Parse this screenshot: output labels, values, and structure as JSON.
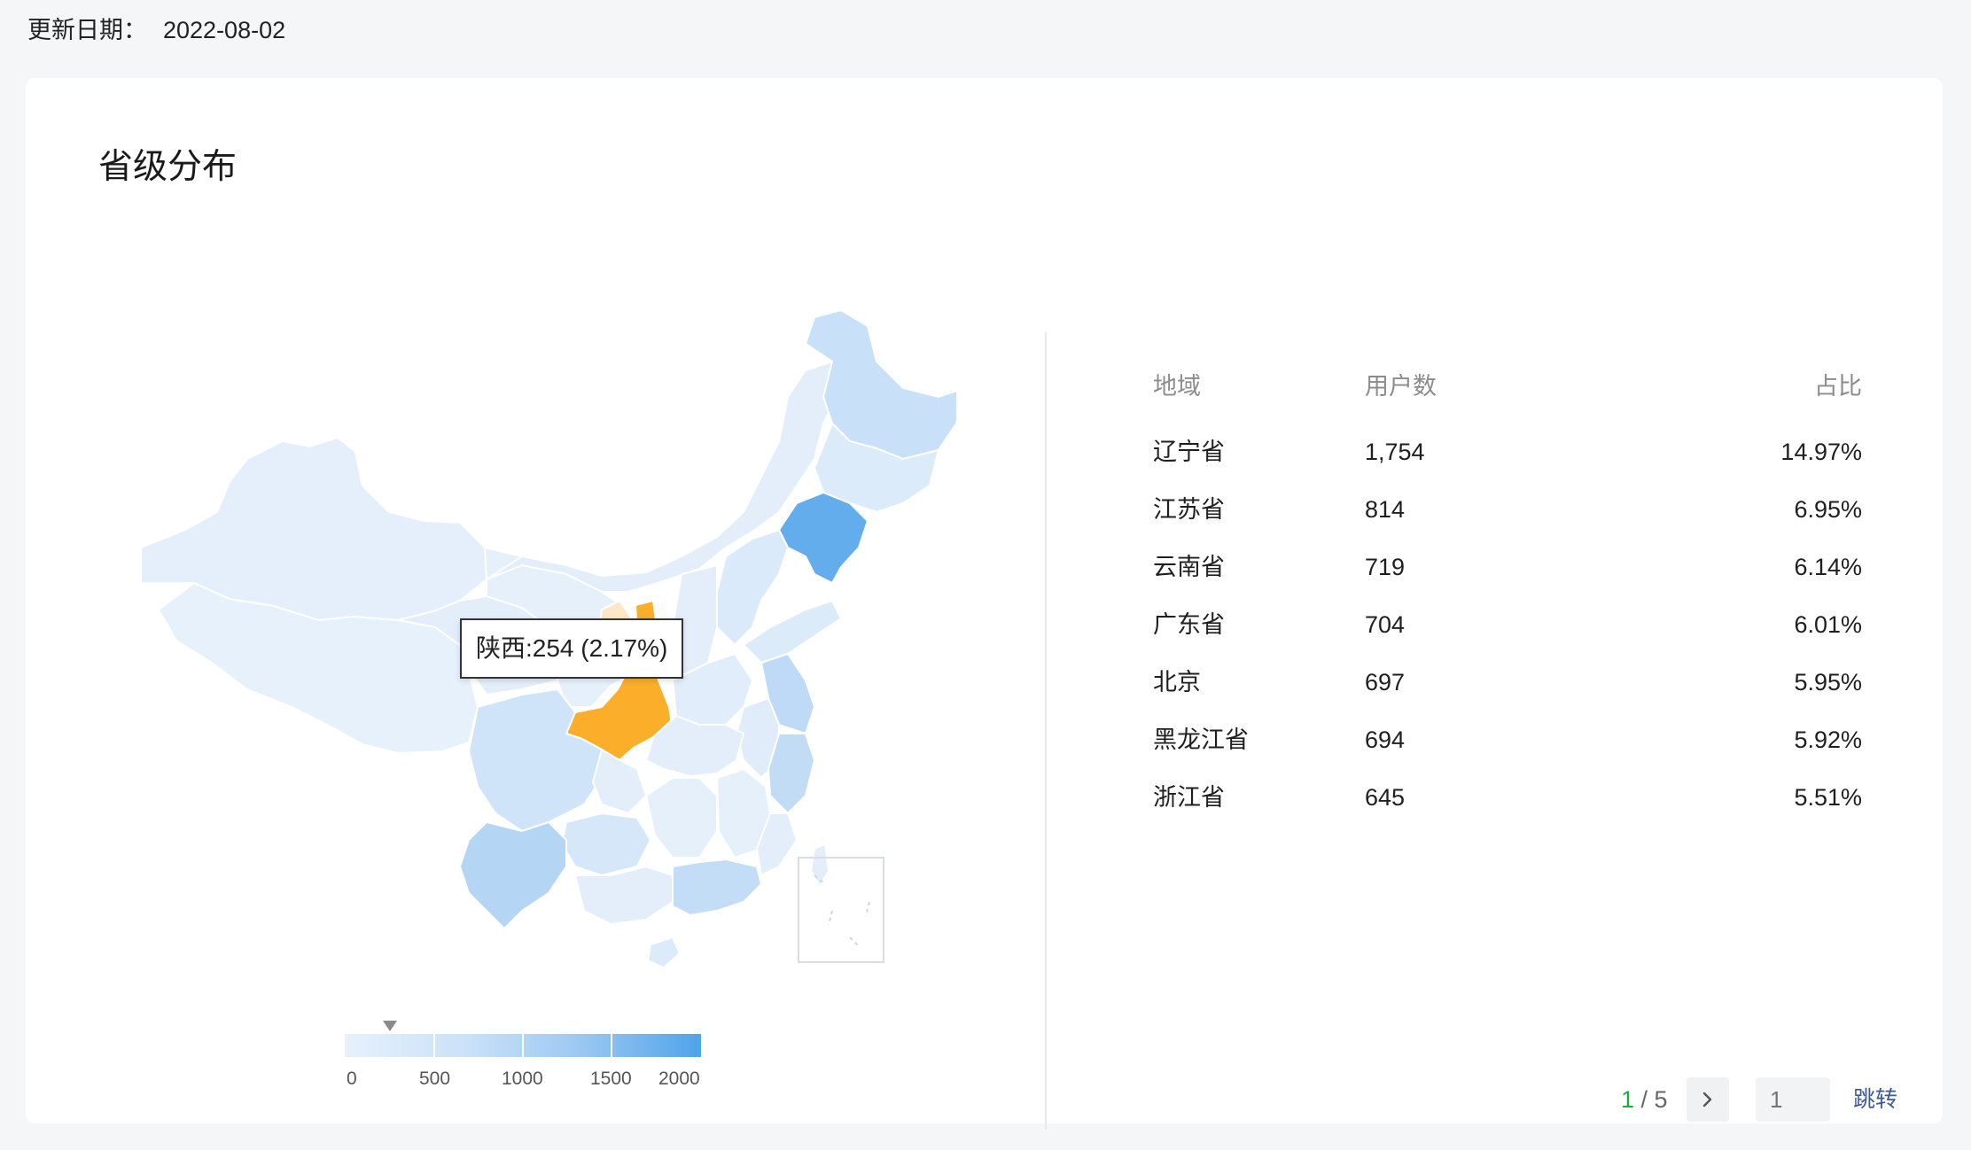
{
  "header": {
    "update_label": "更新日期：",
    "update_value": "2022-08-02"
  },
  "card": {
    "title": "省级分布"
  },
  "map": {
    "tooltip": "陕西:254 (2.17%)",
    "highlight_color": "#fbae2a",
    "visual_map": {
      "min": 0,
      "max": 2000,
      "ticks": [
        "0",
        "500",
        "1000",
        "1500",
        "2000"
      ],
      "current_value": 254,
      "color_low": "#e6f1fc",
      "color_high": "#4fa3ea"
    }
  },
  "table": {
    "headers": {
      "region": "地域",
      "users": "用户数",
      "share": "占比"
    },
    "rows": [
      {
        "region": "辽宁省",
        "users": "1,754",
        "share": "14.97%"
      },
      {
        "region": "江苏省",
        "users": "814",
        "share": "6.95%"
      },
      {
        "region": "云南省",
        "users": "719",
        "share": "6.14%"
      },
      {
        "region": "广东省",
        "users": "704",
        "share": "6.01%"
      },
      {
        "region": "北京",
        "users": "697",
        "share": "5.95%"
      },
      {
        "region": "黑龙江省",
        "users": "694",
        "share": "5.92%"
      },
      {
        "region": "浙江省",
        "users": "645",
        "share": "5.51%"
      }
    ]
  },
  "pagination": {
    "current": "1",
    "separator": " / ",
    "total": "5",
    "jump_placeholder": "1",
    "jump_label": "跳转",
    "next_icon": "chevron-right-icon"
  }
}
